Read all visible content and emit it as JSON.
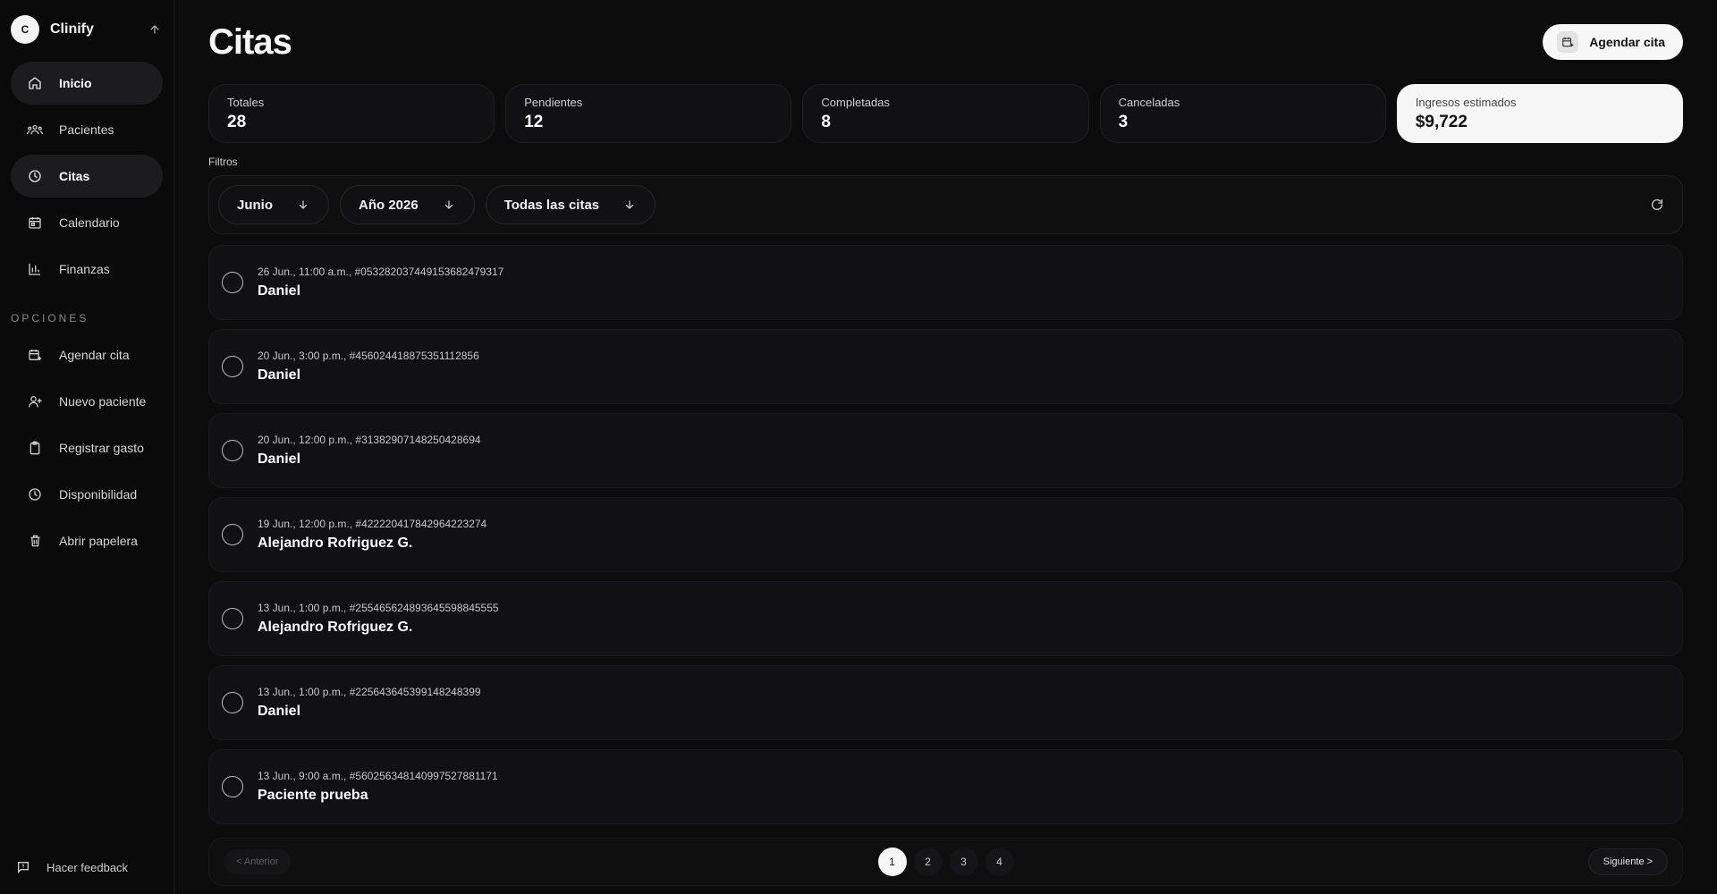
{
  "brand": {
    "initial": "C",
    "name": "Clinify"
  },
  "sidebar": {
    "nav": [
      {
        "label": "Inicio",
        "icon": "home-icon",
        "active": true
      },
      {
        "label": "Pacientes",
        "icon": "users-icon",
        "active": false
      },
      {
        "label": "Citas",
        "icon": "clock-icon",
        "active": true
      },
      {
        "label": "Calendario",
        "icon": "calendar-icon",
        "active": false
      },
      {
        "label": "Finanzas",
        "icon": "bar-chart-icon",
        "active": false
      }
    ],
    "section_label": "OPCIONES",
    "options": [
      {
        "label": "Agendar cita",
        "icon": "calendar-plus-icon"
      },
      {
        "label": "Nuevo paciente",
        "icon": "user-plus-icon"
      },
      {
        "label": "Registrar gasto",
        "icon": "clipboard-icon"
      },
      {
        "label": "Disponibilidad",
        "icon": "clock-icon"
      },
      {
        "label": "Abrir papelera",
        "icon": "trash-icon"
      }
    ],
    "feedback_label": "Hacer feedback"
  },
  "header": {
    "title": "Citas",
    "action_label": "Agendar cita"
  },
  "stats": [
    {
      "label": "Totales",
      "value": "28"
    },
    {
      "label": "Pendientes",
      "value": "12"
    },
    {
      "label": "Completadas",
      "value": "8"
    },
    {
      "label": "Canceladas",
      "value": "3"
    },
    {
      "label": "Ingresos estimados",
      "value": "$9,722"
    }
  ],
  "filters": {
    "label": "Filtros",
    "month": "Junio",
    "year": "Año 2026",
    "type": "Todas las citas"
  },
  "appointments": [
    {
      "meta": "26 Jun., 11:00 a.m., #053282037449153682479317",
      "name": "Daniel"
    },
    {
      "meta": "20 Jun., 3:00 p.m., #456024418875351112856",
      "name": "Daniel"
    },
    {
      "meta": "20 Jun., 12:00 p.m., #31382907148250428694",
      "name": "Daniel"
    },
    {
      "meta": "19 Jun., 12:00 p.m., #422220417842964223274",
      "name": "Alejandro Rofriguez G."
    },
    {
      "meta": "13 Jun., 1:00 p.m., #255465624893645598845555",
      "name": "Alejandro Rofriguez G."
    },
    {
      "meta": "13 Jun., 1:00 p.m., #225643645399148248399",
      "name": "Daniel"
    },
    {
      "meta": "13 Jun., 9:00 a.m., #560256348140997527881171",
      "name": "Paciente prueba"
    }
  ],
  "pagination": {
    "prev_label": "< Anterior",
    "next_label": "Siguiente >",
    "pages": [
      "1",
      "2",
      "3",
      "4"
    ],
    "current": "1"
  },
  "colors": {
    "background": "#0c0c0d",
    "card": "#111113",
    "accent": "#f6f6f6"
  }
}
